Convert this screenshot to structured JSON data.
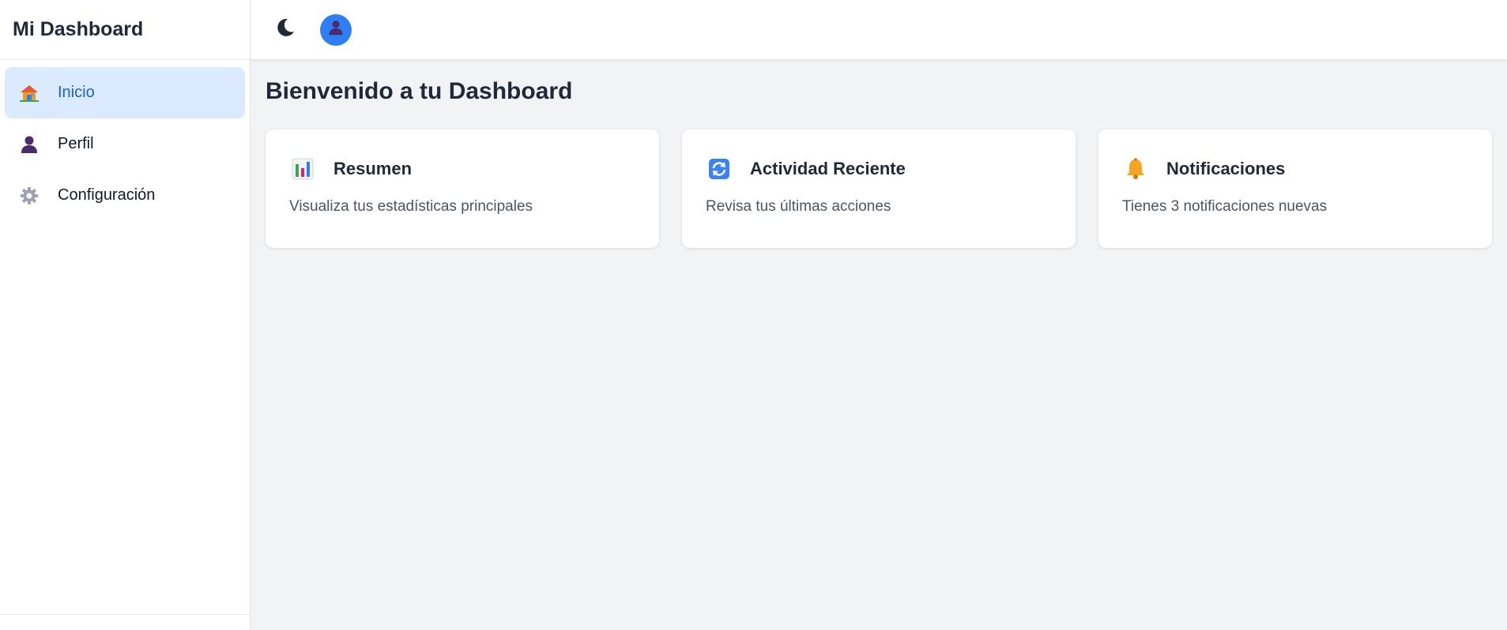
{
  "sidebar": {
    "title": "Mi Dashboard",
    "items": [
      {
        "label": "Inicio",
        "icon": "house-icon",
        "active": true
      },
      {
        "label": "Perfil",
        "icon": "user-silhouette-icon",
        "active": false
      },
      {
        "label": "Configuración",
        "icon": "gear-icon",
        "active": false
      }
    ]
  },
  "topbar": {
    "theme_icon": "moon-icon",
    "avatar_icon": "user-silhouette-icon"
  },
  "main": {
    "title": "Bienvenido a tu Dashboard",
    "cards": [
      {
        "title": "Resumen",
        "description": "Visualiza tus estadísticas principales",
        "icon": "bar-chart-icon"
      },
      {
        "title": "Actividad Reciente",
        "description": "Revisa tus últimas acciones",
        "icon": "refresh-icon"
      },
      {
        "title": "Notificaciones",
        "description": "Tienes 3 notificaciones nuevas",
        "icon": "bell-icon"
      }
    ]
  },
  "colors": {
    "accent": "#2f7ff4",
    "active_bg": "#dbeafe",
    "active_text": "#1d5fd1",
    "background": "#f2f3f5"
  }
}
